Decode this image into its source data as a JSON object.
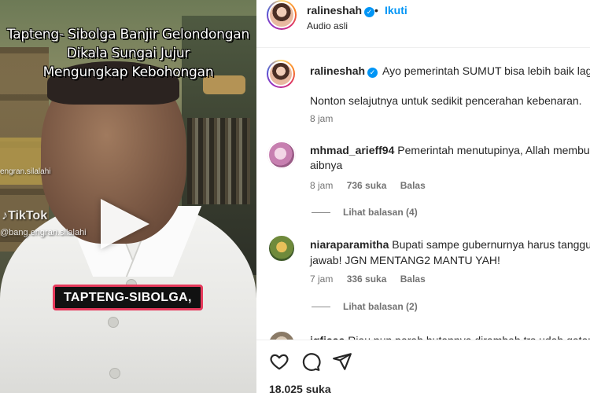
{
  "video": {
    "overlay_title_lines": [
      "Tapteng- Sibolga Banjir Gelondongan",
      "Dikala Sungai Jujur",
      "Mengungkap Kebohongan"
    ],
    "tiktok_logo": "TikTok",
    "tiktok_user": "@bang.engran.silalahi",
    "watermark_top": "engran.silalahi",
    "caption_badge": "TAPTENG-SIBOLGA,"
  },
  "post": {
    "author": "ralineshah",
    "follow_label": "Ikuti",
    "separator": "•",
    "audio": "Audio asli",
    "caption": {
      "user": "ralineshah",
      "text_line1": "Ayo pemerintah SUMUT bisa lebih baik lagi.",
      "text_line2": "Nonton selajutnya untuk sedikit pencerahan kebenaran.",
      "time": "8 jam"
    },
    "comments": [
      {
        "user": "mhmad_arieff94",
        "text_line1": "Pemerintah menutupinya, Allah membuk",
        "text_line2": "aibnya",
        "time": "8 jam",
        "likes": "736 suka",
        "reply_label": "Balas",
        "view_replies": "Lihat balasan (4)"
      },
      {
        "user": "niaraparamitha",
        "text_line1": "Bupati sampe gubernurnya harus tanggun",
        "text_line2": "jawab! JGN MENTANG2 MANTU YAH!",
        "time": "7 jam",
        "likes": "336 suka",
        "reply_label": "Balas",
        "view_replies": "Lihat balasan (2)"
      },
      {
        "user": "igfiaaa",
        "text_line1": "Riau pun parah hutannya dirambah trs udah gataur",
        "text_line2": ""
      }
    ],
    "likes_total": "18.025 suka"
  },
  "icons": {
    "like": "heart-icon",
    "comment": "comment-icon",
    "share": "send-icon",
    "verified": "verified-badge-icon",
    "play": "play-icon"
  },
  "colors": {
    "accent": "#0095f6",
    "badge_border": "#e63a5c",
    "muted": "#737373"
  }
}
